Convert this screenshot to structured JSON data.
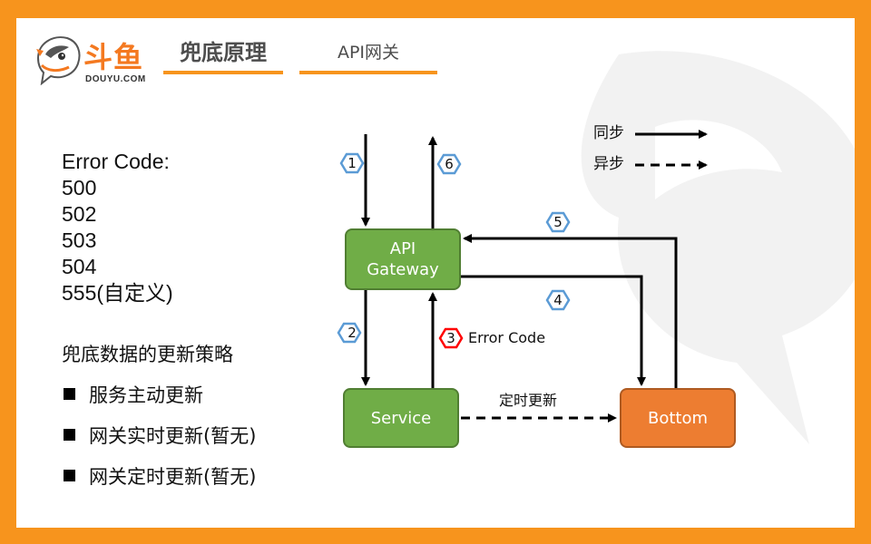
{
  "brand": {
    "name": "斗鱼",
    "domain": "DOUYU.COM",
    "color": "#f47920"
  },
  "colors": {
    "frame": "#f7941d",
    "service_green": "#70ad47",
    "bottom_orange": "#ed7d31",
    "step_badge_blue": "#5b9bd5",
    "step_badge_red": "#ff0000"
  },
  "tabs": [
    {
      "label": "兜底原理",
      "active": true
    },
    {
      "label": "API网关",
      "active": false
    }
  ],
  "error_codes": {
    "title": "Error Code:",
    "codes": [
      "500",
      "502",
      "503",
      "504",
      "555(自定义)"
    ]
  },
  "strategy": {
    "title": "兜底数据的更新策略",
    "items": [
      "服务主动更新",
      "网关实时更新(暂无)",
      "网关定时更新(暂无)"
    ]
  },
  "legend": {
    "sync": "同步",
    "async": "异步"
  },
  "nodes": {
    "gateway_line1": "API",
    "gateway_line2": "Gateway",
    "service": "Service",
    "bottom": "Bottom"
  },
  "steps": [
    "1",
    "2",
    "3",
    "4",
    "5",
    "6"
  ],
  "edge_labels": {
    "error_code": "Error Code",
    "scheduled_update": "定时更新"
  }
}
